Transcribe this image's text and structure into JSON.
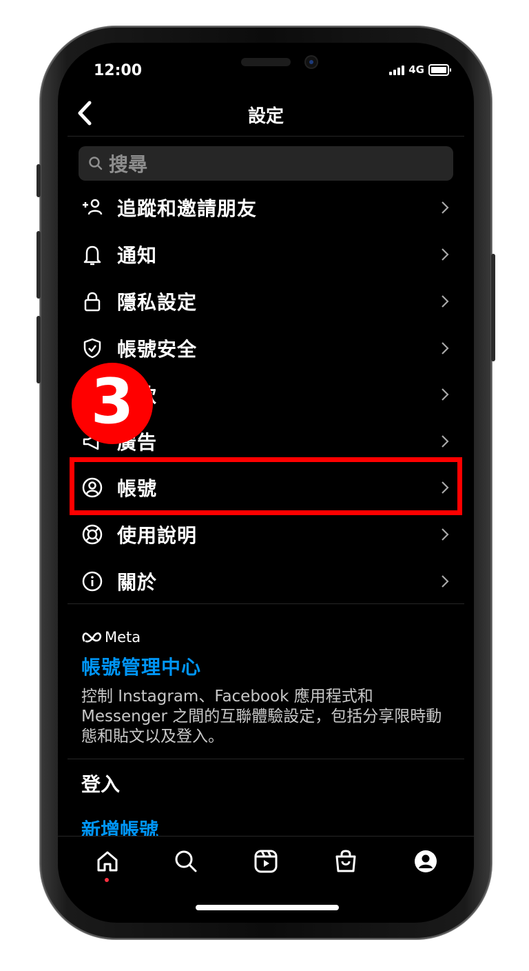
{
  "status": {
    "time": "12:00",
    "network": "4G"
  },
  "header": {
    "title": "設定"
  },
  "search": {
    "placeholder": "搜尋"
  },
  "menu": [
    {
      "label": "追蹤和邀請朋友",
      "icon": "add-person-icon"
    },
    {
      "label": "通知",
      "icon": "bell-icon"
    },
    {
      "label": "隱私設定",
      "icon": "lock-icon"
    },
    {
      "label": "帳號安全",
      "icon": "shield-check-icon"
    },
    {
      "label": "付款",
      "icon": "card-icon"
    },
    {
      "label": "廣告",
      "icon": "megaphone-icon"
    },
    {
      "label": "帳號",
      "icon": "person-circle-icon"
    },
    {
      "label": "使用說明",
      "icon": "lifebuoy-icon"
    },
    {
      "label": "關於",
      "icon": "info-icon"
    }
  ],
  "accounts_center": {
    "brand": "Meta",
    "title": "帳號管理中心",
    "description": "控制 Instagram、Facebook 應用程式和 Messenger 之間的互聯體驗設定，包括分享限時動態和貼文以及登入。"
  },
  "login": {
    "label": "登入",
    "add_account": "新增帳號"
  },
  "tabs": [
    "home-icon",
    "search-icon",
    "reels-icon",
    "shop-icon",
    "profile-icon"
  ],
  "annotation": {
    "step": "3",
    "color": "#ff0000"
  },
  "colors": {
    "link": "#0095f6",
    "background": "#000000"
  }
}
